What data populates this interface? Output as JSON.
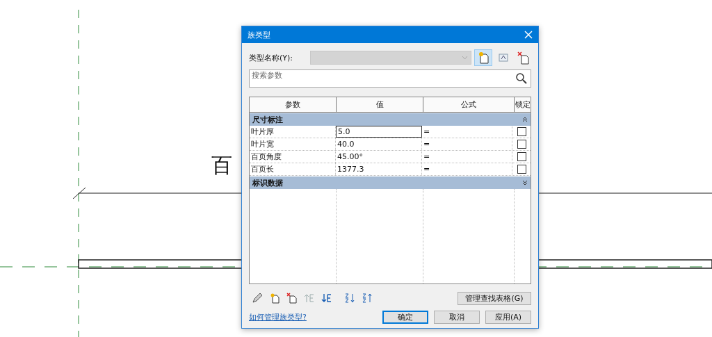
{
  "canvas": {
    "label": "百"
  },
  "dialog": {
    "title": "族类型",
    "type_name": {
      "label": "类型名称(Y):",
      "disabled": true
    },
    "search": {
      "placeholder": "搜索参数"
    },
    "table": {
      "columns": [
        "参数",
        "值",
        "公式",
        "锁定"
      ],
      "groups": [
        {
          "name": "尺寸标注",
          "expanded": true,
          "rows": [
            {
              "parameter": "叶片厚",
              "value": "5.0",
              "formula": "=",
              "locked": false,
              "selected": true
            },
            {
              "parameter": "叶片宽",
              "value": "40.0",
              "formula": "=",
              "locked": false,
              "selected": false
            },
            {
              "parameter": "百页角度",
              "value": "45.00°",
              "formula": "=",
              "locked": false,
              "selected": false
            },
            {
              "parameter": "百页长",
              "value": "1377.3",
              "formula": "=",
              "locked": false,
              "selected": false
            }
          ]
        },
        {
          "name": "标识数据",
          "expanded": false
        }
      ]
    },
    "lookup_button": "管理查找表格(G)",
    "help_link": "如何管理族类型?",
    "buttons": [
      {
        "label": "确定",
        "default": true
      },
      {
        "label": "取消",
        "default": false
      },
      {
        "label": "应用(A)",
        "default": false
      }
    ]
  }
}
